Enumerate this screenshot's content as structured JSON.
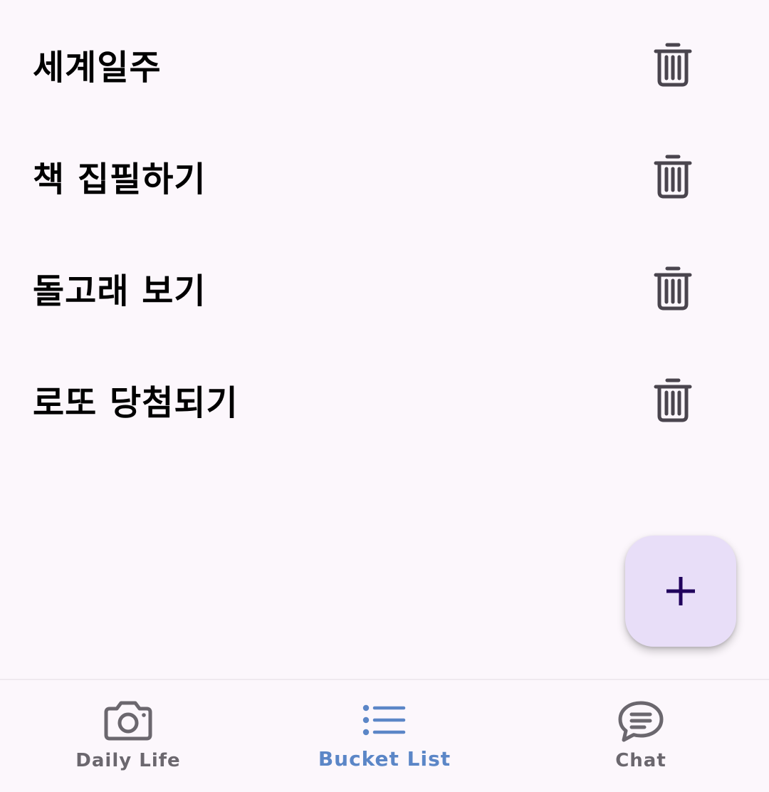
{
  "bucket_list": {
    "items": [
      {
        "title": "세계일주",
        "delete_icon": "trash-icon"
      },
      {
        "title": "책 집필하기",
        "delete_icon": "trash-icon"
      },
      {
        "title": "돌고래 보기",
        "delete_icon": "trash-icon"
      },
      {
        "title": "로또 당첨되기",
        "delete_icon": "trash-icon"
      }
    ]
  },
  "fab": {
    "icon": "plus-icon"
  },
  "bottom_nav": {
    "items": [
      {
        "label": "Daily Life",
        "icon": "camera-icon",
        "active": false
      },
      {
        "label": "Bucket List",
        "icon": "list-icon",
        "active": true
      },
      {
        "label": "Chat",
        "icon": "chat-bubble-icon",
        "active": false
      }
    ]
  },
  "colors": {
    "background": "#fcf7fc",
    "text": "#000000",
    "icon": "#4a454e",
    "fab_background": "#e8def8",
    "fab_icon": "#21005d",
    "nav_active": "#5b86c7",
    "nav_inactive": "#6b676e"
  }
}
